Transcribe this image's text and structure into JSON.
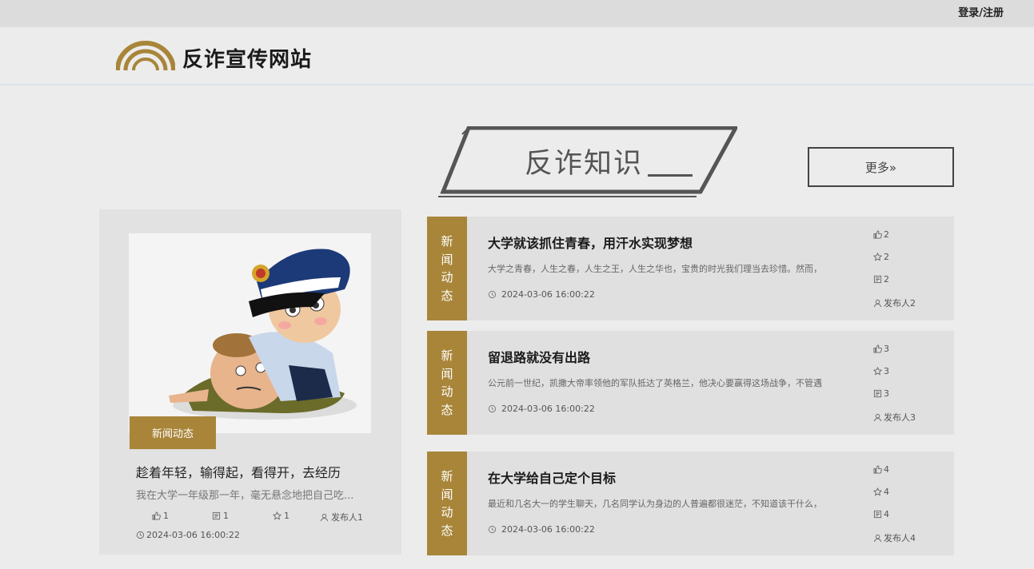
{
  "topbar": {
    "login_label": "登录/注册"
  },
  "header": {
    "site_title": "反诈宣传网站"
  },
  "section": {
    "title": "反诈知识",
    "more_label": "更多»"
  },
  "feature": {
    "tag": "新闻动态",
    "title": "趁着年轻，输得起，看得开，去经历",
    "summary": "我在大学一年级那一年，毫无悬念地把自己吃...",
    "likes": "1",
    "comments": "1",
    "favorites": "1",
    "publisher": "发布人1",
    "date": "2024-03-06 16:00:22"
  },
  "news": [
    {
      "category_chars": [
        "新",
        "闻",
        "动",
        "态"
      ],
      "title": "大学就该抓住青春，用汗水实现梦想",
      "summary": "大学之青春，人生之春，人生之王，人生之华也，宝贵的时光我们理当去珍惜。然而，",
      "date": "2024-03-06 16:00:22",
      "likes": "2",
      "favorites": "2",
      "comments": "2",
      "publisher": "发布人2"
    },
    {
      "category_chars": [
        "新",
        "闻",
        "动",
        "态"
      ],
      "title": "留退路就没有出路",
      "summary": "公元前一世纪，凯撒大帝率领他的军队抵达了英格兰，他决心要赢得这场战争，不管遇",
      "date": "2024-03-06 16:00:22",
      "likes": "3",
      "favorites": "3",
      "comments": "3",
      "publisher": "发布人3"
    },
    {
      "category_chars": [
        "新",
        "闻",
        "动",
        "态"
      ],
      "title": "在大学给自己定个目标",
      "summary": "最近和几名大一的学生聊天，几名同学认为身边的人普遍都很迷茫，不知道该干什么，",
      "date": "2024-03-06 16:00:22",
      "likes": "4",
      "favorites": "4",
      "comments": "4",
      "publisher": "发布人4"
    }
  ]
}
